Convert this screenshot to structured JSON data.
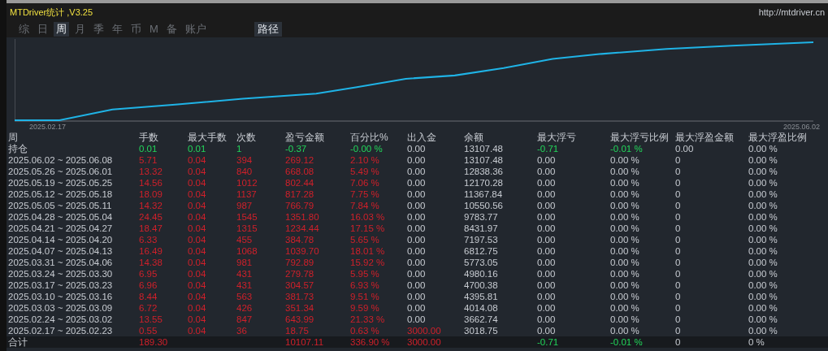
{
  "window": {
    "title": "MTDriver统计 ,V3.25",
    "link": "http://mtdriver.cn"
  },
  "tabs": [
    {
      "label": "综",
      "selected": false
    },
    {
      "label": "日",
      "selected": false
    },
    {
      "label": "周",
      "selected": true
    },
    {
      "label": "月",
      "selected": false
    },
    {
      "label": "季",
      "selected": false
    },
    {
      "label": "年",
      "selected": false
    },
    {
      "label": "币",
      "selected": false
    },
    {
      "label": "M",
      "selected": false
    },
    {
      "label": "备",
      "selected": false
    },
    {
      "label": "账户",
      "selected": false
    }
  ],
  "path_button": {
    "label": "路径"
  },
  "chart": {
    "start_date": "2025.02.17",
    "end_date": "2025.06.02"
  },
  "table": {
    "columns": [
      "周",
      "手数",
      "最大手数",
      "次数",
      "盈亏金额",
      "百分比%",
      "出入金",
      "余额",
      "最大浮亏",
      "最大浮亏比例",
      "最大浮盈金额",
      "最大浮盈比例"
    ],
    "rows": [
      {
        "kind": "open",
        "cells": [
          {
            "text": "持仓",
            "kind": "plain"
          },
          {
            "text": "0.01",
            "kind": "down"
          },
          {
            "text": "0.01",
            "kind": "down"
          },
          {
            "text": "1",
            "kind": "down"
          },
          {
            "text": "-0.37",
            "kind": "down"
          },
          {
            "text": "-0.00 %",
            "kind": "down"
          },
          {
            "text": "0.00",
            "kind": "plain"
          },
          {
            "text": "13107.48",
            "kind": "plain"
          },
          {
            "text": "-0.71",
            "kind": "down"
          },
          {
            "text": "-0.01 %",
            "kind": "down"
          },
          {
            "text": "0.00",
            "kind": "plain"
          },
          {
            "text": "0.00 %",
            "kind": "plain"
          }
        ]
      },
      {
        "kind": "week",
        "cells": [
          {
            "text": "2025.06.02 ~ 2025.06.08",
            "kind": "plain"
          },
          {
            "text": "5.71",
            "kind": "up"
          },
          {
            "text": "0.04",
            "kind": "up"
          },
          {
            "text": "394",
            "kind": "up"
          },
          {
            "text": "269.12",
            "kind": "up"
          },
          {
            "text": "2.10 %",
            "kind": "up"
          },
          {
            "text": "0.00",
            "kind": "plain"
          },
          {
            "text": "13107.48",
            "kind": "plain"
          },
          {
            "text": "0.00",
            "kind": "plain"
          },
          {
            "text": "0.00 %",
            "kind": "plain"
          },
          {
            "text": "0",
            "kind": "plain"
          },
          {
            "text": "0.00 %",
            "kind": "plain"
          }
        ]
      },
      {
        "kind": "week",
        "cells": [
          {
            "text": "2025.05.26 ~ 2025.06.01",
            "kind": "plain"
          },
          {
            "text": "13.32",
            "kind": "up"
          },
          {
            "text": "0.04",
            "kind": "up"
          },
          {
            "text": "840",
            "kind": "up"
          },
          {
            "text": "668.08",
            "kind": "up"
          },
          {
            "text": "5.49 %",
            "kind": "up"
          },
          {
            "text": "0.00",
            "kind": "plain"
          },
          {
            "text": "12838.36",
            "kind": "plain"
          },
          {
            "text": "0.00",
            "kind": "plain"
          },
          {
            "text": "0.00 %",
            "kind": "plain"
          },
          {
            "text": "0",
            "kind": "plain"
          },
          {
            "text": "0.00 %",
            "kind": "plain"
          }
        ]
      },
      {
        "kind": "week",
        "cells": [
          {
            "text": "2025.05.19 ~ 2025.05.25",
            "kind": "plain"
          },
          {
            "text": "14.56",
            "kind": "up"
          },
          {
            "text": "0.04",
            "kind": "up"
          },
          {
            "text": "1012",
            "kind": "up"
          },
          {
            "text": "802.44",
            "kind": "up"
          },
          {
            "text": "7.06 %",
            "kind": "up"
          },
          {
            "text": "0.00",
            "kind": "plain"
          },
          {
            "text": "12170.28",
            "kind": "plain"
          },
          {
            "text": "0.00",
            "kind": "plain"
          },
          {
            "text": "0.00 %",
            "kind": "plain"
          },
          {
            "text": "0",
            "kind": "plain"
          },
          {
            "text": "0.00 %",
            "kind": "plain"
          }
        ]
      },
      {
        "kind": "week",
        "cells": [
          {
            "text": "2025.05.12 ~ 2025.05.18",
            "kind": "plain"
          },
          {
            "text": "18.09",
            "kind": "up"
          },
          {
            "text": "0.04",
            "kind": "up"
          },
          {
            "text": "1137",
            "kind": "up"
          },
          {
            "text": "817.28",
            "kind": "up"
          },
          {
            "text": "7.75 %",
            "kind": "up"
          },
          {
            "text": "0.00",
            "kind": "plain"
          },
          {
            "text": "11367.84",
            "kind": "plain"
          },
          {
            "text": "0.00",
            "kind": "plain"
          },
          {
            "text": "0.00 %",
            "kind": "plain"
          },
          {
            "text": "0",
            "kind": "plain"
          },
          {
            "text": "0.00 %",
            "kind": "plain"
          }
        ]
      },
      {
        "kind": "week",
        "cells": [
          {
            "text": "2025.05.05 ~ 2025.05.11",
            "kind": "plain"
          },
          {
            "text": "14.32",
            "kind": "up"
          },
          {
            "text": "0.04",
            "kind": "up"
          },
          {
            "text": "987",
            "kind": "up"
          },
          {
            "text": "766.79",
            "kind": "up"
          },
          {
            "text": "7.84 %",
            "kind": "up"
          },
          {
            "text": "0.00",
            "kind": "plain"
          },
          {
            "text": "10550.56",
            "kind": "plain"
          },
          {
            "text": "0.00",
            "kind": "plain"
          },
          {
            "text": "0.00 %",
            "kind": "plain"
          },
          {
            "text": "0",
            "kind": "plain"
          },
          {
            "text": "0.00 %",
            "kind": "plain"
          }
        ]
      },
      {
        "kind": "week",
        "cells": [
          {
            "text": "2025.04.28 ~ 2025.05.04",
            "kind": "plain"
          },
          {
            "text": "24.45",
            "kind": "up"
          },
          {
            "text": "0.04",
            "kind": "up"
          },
          {
            "text": "1545",
            "kind": "up"
          },
          {
            "text": "1351.80",
            "kind": "up"
          },
          {
            "text": "16.03 %",
            "kind": "up"
          },
          {
            "text": "0.00",
            "kind": "plain"
          },
          {
            "text": "9783.77",
            "kind": "plain"
          },
          {
            "text": "0.00",
            "kind": "plain"
          },
          {
            "text": "0.00 %",
            "kind": "plain"
          },
          {
            "text": "0",
            "kind": "plain"
          },
          {
            "text": "0.00 %",
            "kind": "plain"
          }
        ]
      },
      {
        "kind": "week",
        "cells": [
          {
            "text": "2025.04.21 ~ 2025.04.27",
            "kind": "plain"
          },
          {
            "text": "18.47",
            "kind": "up"
          },
          {
            "text": "0.04",
            "kind": "up"
          },
          {
            "text": "1315",
            "kind": "up"
          },
          {
            "text": "1234.44",
            "kind": "up"
          },
          {
            "text": "17.15 %",
            "kind": "up"
          },
          {
            "text": "0.00",
            "kind": "plain"
          },
          {
            "text": "8431.97",
            "kind": "plain"
          },
          {
            "text": "0.00",
            "kind": "plain"
          },
          {
            "text": "0.00 %",
            "kind": "plain"
          },
          {
            "text": "0",
            "kind": "plain"
          },
          {
            "text": "0.00 %",
            "kind": "plain"
          }
        ]
      },
      {
        "kind": "week",
        "cells": [
          {
            "text": "2025.04.14 ~ 2025.04.20",
            "kind": "plain"
          },
          {
            "text": "6.33",
            "kind": "up"
          },
          {
            "text": "0.04",
            "kind": "up"
          },
          {
            "text": "455",
            "kind": "up"
          },
          {
            "text": "384.78",
            "kind": "up"
          },
          {
            "text": "5.65 %",
            "kind": "up"
          },
          {
            "text": "0.00",
            "kind": "plain"
          },
          {
            "text": "7197.53",
            "kind": "plain"
          },
          {
            "text": "0.00",
            "kind": "plain"
          },
          {
            "text": "0.00 %",
            "kind": "plain"
          },
          {
            "text": "0",
            "kind": "plain"
          },
          {
            "text": "0.00 %",
            "kind": "plain"
          }
        ]
      },
      {
        "kind": "week",
        "cells": [
          {
            "text": "2025.04.07 ~ 2025.04.13",
            "kind": "plain"
          },
          {
            "text": "16.49",
            "kind": "up"
          },
          {
            "text": "0.04",
            "kind": "up"
          },
          {
            "text": "1068",
            "kind": "up"
          },
          {
            "text": "1039.70",
            "kind": "up"
          },
          {
            "text": "18.01 %",
            "kind": "up"
          },
          {
            "text": "0.00",
            "kind": "plain"
          },
          {
            "text": "6812.75",
            "kind": "plain"
          },
          {
            "text": "0.00",
            "kind": "plain"
          },
          {
            "text": "0.00 %",
            "kind": "plain"
          },
          {
            "text": "0",
            "kind": "plain"
          },
          {
            "text": "0.00 %",
            "kind": "plain"
          }
        ]
      },
      {
        "kind": "week",
        "cells": [
          {
            "text": "2025.03.31 ~ 2025.04.06",
            "kind": "plain"
          },
          {
            "text": "14.38",
            "kind": "up"
          },
          {
            "text": "0.04",
            "kind": "up"
          },
          {
            "text": "981",
            "kind": "up"
          },
          {
            "text": "792.89",
            "kind": "up"
          },
          {
            "text": "15.92 %",
            "kind": "up"
          },
          {
            "text": "0.00",
            "kind": "plain"
          },
          {
            "text": "5773.05",
            "kind": "plain"
          },
          {
            "text": "0.00",
            "kind": "plain"
          },
          {
            "text": "0.00 %",
            "kind": "plain"
          },
          {
            "text": "0",
            "kind": "plain"
          },
          {
            "text": "0.00 %",
            "kind": "plain"
          }
        ]
      },
      {
        "kind": "week",
        "cells": [
          {
            "text": "2025.03.24 ~ 2025.03.30",
            "kind": "plain"
          },
          {
            "text": "6.95",
            "kind": "up"
          },
          {
            "text": "0.04",
            "kind": "up"
          },
          {
            "text": "431",
            "kind": "up"
          },
          {
            "text": "279.78",
            "kind": "up"
          },
          {
            "text": "5.95 %",
            "kind": "up"
          },
          {
            "text": "0.00",
            "kind": "plain"
          },
          {
            "text": "4980.16",
            "kind": "plain"
          },
          {
            "text": "0.00",
            "kind": "plain"
          },
          {
            "text": "0.00 %",
            "kind": "plain"
          },
          {
            "text": "0",
            "kind": "plain"
          },
          {
            "text": "0.00 %",
            "kind": "plain"
          }
        ]
      },
      {
        "kind": "week",
        "cells": [
          {
            "text": "2025.03.17 ~ 2025.03.23",
            "kind": "plain"
          },
          {
            "text": "6.96",
            "kind": "up"
          },
          {
            "text": "0.04",
            "kind": "up"
          },
          {
            "text": "431",
            "kind": "up"
          },
          {
            "text": "304.57",
            "kind": "up"
          },
          {
            "text": "6.93 %",
            "kind": "up"
          },
          {
            "text": "0.00",
            "kind": "plain"
          },
          {
            "text": "4700.38",
            "kind": "plain"
          },
          {
            "text": "0.00",
            "kind": "plain"
          },
          {
            "text": "0.00 %",
            "kind": "plain"
          },
          {
            "text": "0",
            "kind": "plain"
          },
          {
            "text": "0.00 %",
            "kind": "plain"
          }
        ]
      },
      {
        "kind": "week",
        "cells": [
          {
            "text": "2025.03.10 ~ 2025.03.16",
            "kind": "plain"
          },
          {
            "text": "8.44",
            "kind": "up"
          },
          {
            "text": "0.04",
            "kind": "up"
          },
          {
            "text": "563",
            "kind": "up"
          },
          {
            "text": "381.73",
            "kind": "up"
          },
          {
            "text": "9.51 %",
            "kind": "up"
          },
          {
            "text": "0.00",
            "kind": "plain"
          },
          {
            "text": "4395.81",
            "kind": "plain"
          },
          {
            "text": "0.00",
            "kind": "plain"
          },
          {
            "text": "0.00 %",
            "kind": "plain"
          },
          {
            "text": "0",
            "kind": "plain"
          },
          {
            "text": "0.00 %",
            "kind": "plain"
          }
        ]
      },
      {
        "kind": "week",
        "cells": [
          {
            "text": "2025.03.03 ~ 2025.03.09",
            "kind": "plain"
          },
          {
            "text": "6.72",
            "kind": "up"
          },
          {
            "text": "0.04",
            "kind": "up"
          },
          {
            "text": "426",
            "kind": "up"
          },
          {
            "text": "351.34",
            "kind": "up"
          },
          {
            "text": "9.59 %",
            "kind": "up"
          },
          {
            "text": "0.00",
            "kind": "plain"
          },
          {
            "text": "4014.08",
            "kind": "plain"
          },
          {
            "text": "0.00",
            "kind": "plain"
          },
          {
            "text": "0.00 %",
            "kind": "plain"
          },
          {
            "text": "0",
            "kind": "plain"
          },
          {
            "text": "0.00 %",
            "kind": "plain"
          }
        ]
      },
      {
        "kind": "week",
        "cells": [
          {
            "text": "2025.02.24 ~ 2025.03.02",
            "kind": "plain"
          },
          {
            "text": "13.55",
            "kind": "up"
          },
          {
            "text": "0.04",
            "kind": "up"
          },
          {
            "text": "847",
            "kind": "up"
          },
          {
            "text": "643.99",
            "kind": "up"
          },
          {
            "text": "21.33 %",
            "kind": "up"
          },
          {
            "text": "0.00",
            "kind": "plain"
          },
          {
            "text": "3662.74",
            "kind": "plain"
          },
          {
            "text": "0.00",
            "kind": "plain"
          },
          {
            "text": "0.00 %",
            "kind": "plain"
          },
          {
            "text": "0",
            "kind": "plain"
          },
          {
            "text": "0.00 %",
            "kind": "plain"
          }
        ]
      },
      {
        "kind": "week",
        "cells": [
          {
            "text": "2025.02.17 ~ 2025.02.23",
            "kind": "plain"
          },
          {
            "text": "0.55",
            "kind": "up"
          },
          {
            "text": "0.04",
            "kind": "up"
          },
          {
            "text": "36",
            "kind": "up"
          },
          {
            "text": "18.75",
            "kind": "up"
          },
          {
            "text": "0.63 %",
            "kind": "up"
          },
          {
            "text": "3000.00",
            "kind": "up"
          },
          {
            "text": "3018.75",
            "kind": "plain"
          },
          {
            "text": "0.00",
            "kind": "plain"
          },
          {
            "text": "0.00 %",
            "kind": "plain"
          },
          {
            "text": "0",
            "kind": "plain"
          },
          {
            "text": "0.00 %",
            "kind": "plain"
          }
        ]
      },
      {
        "kind": "total",
        "cells": [
          {
            "text": "合计",
            "kind": "plain"
          },
          {
            "text": "189.30",
            "kind": "up"
          },
          null,
          null,
          {
            "text": "10107.11",
            "kind": "up"
          },
          {
            "text": "336.90 %",
            "kind": "up"
          },
          {
            "text": "3000.00",
            "kind": "up"
          },
          null,
          {
            "text": "-0.71",
            "kind": "down"
          },
          {
            "text": "-0.01 %",
            "kind": "down"
          },
          {
            "text": "0",
            "kind": "plain"
          },
          {
            "text": "0 %",
            "kind": "plain"
          }
        ]
      }
    ]
  }
}
